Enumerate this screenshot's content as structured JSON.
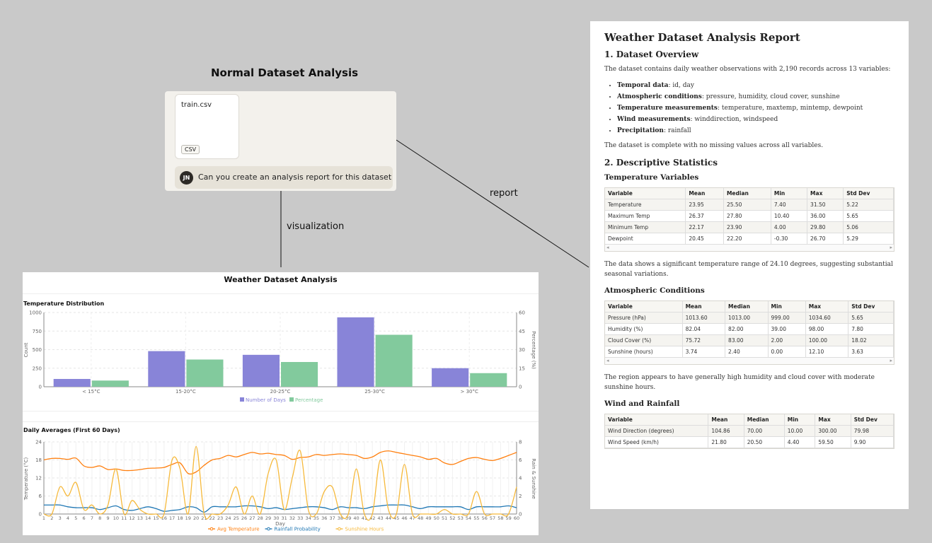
{
  "normal": {
    "title": "Normal Dataset Analysis",
    "file_name": "train.csv",
    "file_type": "CSV",
    "avatar_initials": "JN",
    "message": "Can you create an analysis report for this dataset"
  },
  "labels": {
    "visualization": "visualization",
    "report": "report"
  },
  "dashboard": {
    "title": "Weather Dataset Analysis",
    "chart1_title": "Temperature Distribution",
    "chart2_title": "Daily Averages (First 60 Days)"
  },
  "chart_data": [
    {
      "type": "bar",
      "title": "Temperature Distribution",
      "categories": [
        "< 15°C",
        "15-20°C",
        "20-25°C",
        "25-30°C",
        "> 30°C"
      ],
      "series": [
        {
          "name": "Number of Days",
          "axis": "left",
          "color": "#8884d8",
          "values": [
            105,
            480,
            430,
            935,
            250
          ]
        },
        {
          "name": "Percentage",
          "axis": "right",
          "color": "#82ca9d",
          "values": [
            5,
            22,
            20,
            42,
            11
          ]
        }
      ],
      "ylabel": "Count",
      "ylim": [
        0,
        1000
      ],
      "yticks": [
        0,
        250,
        500,
        750,
        1000
      ],
      "y2label": "Percentage (%)",
      "y2lim": [
        0,
        60
      ],
      "y2ticks": [
        0,
        15,
        30,
        45,
        60
      ],
      "legend": "bottom",
      "grid": true
    },
    {
      "type": "line",
      "title": "Daily Averages (First 60 Days)",
      "xlabel": "Day",
      "x": [
        1,
        2,
        3,
        4,
        5,
        6,
        7,
        8,
        9,
        10,
        11,
        12,
        13,
        14,
        15,
        16,
        17,
        18,
        19,
        20,
        21,
        22,
        23,
        24,
        25,
        26,
        27,
        28,
        29,
        30,
        31,
        32,
        33,
        34,
        35,
        36,
        37,
        38,
        39,
        40,
        41,
        42,
        43,
        44,
        45,
        46,
        47,
        48,
        49,
        50,
        51,
        52,
        53,
        54,
        55,
        56,
        57,
        58,
        59,
        60
      ],
      "ylabel": "Temperature (°C)",
      "ylim": [
        0,
        24
      ],
      "yticks": [
        0,
        6,
        12,
        18,
        24
      ],
      "y2label": "Rain & Sunshine",
      "y2lim": [
        0,
        8
      ],
      "y2ticks": [
        0,
        2,
        4,
        6,
        8
      ],
      "legend": "bottom",
      "grid": true,
      "series": [
        {
          "name": "Avg Temperature",
          "axis": "left",
          "color": "#ff7f0e",
          "values": [
            18,
            18.5,
            18.5,
            18.2,
            18.6,
            16,
            15.5,
            16,
            14.8,
            15,
            14.5,
            14.5,
            14.8,
            15.2,
            15.3,
            15.5,
            16.5,
            17,
            13.5,
            14,
            16.2,
            18,
            18.5,
            19.5,
            19,
            19.8,
            20.5,
            20,
            20.2,
            19.8,
            19.5,
            18.2,
            18.8,
            19,
            19.8,
            19.5,
            19.8,
            20,
            19.8,
            19.5,
            18.5,
            19,
            20.5,
            21,
            20.5,
            20,
            19.5,
            19,
            18.2,
            18.5,
            17,
            16.5,
            17.5,
            18.5,
            18.8,
            18.2,
            17.8,
            18.5,
            19.5,
            20.5
          ]
        },
        {
          "name": "Rainfall Probability",
          "axis": "right",
          "color": "#1f77b4",
          "values": [
            1,
            1,
            1,
            0.8,
            0.7,
            0.7,
            0.7,
            0.5,
            0.7,
            0.9,
            0.5,
            0.4,
            0.6,
            0.8,
            0.6,
            0.3,
            0.4,
            0.5,
            0.8,
            0.7,
            0.2,
            0.8,
            0.8,
            0.8,
            0.8,
            0.9,
            0.9,
            0.8,
            0.6,
            0.7,
            0.5,
            0.6,
            0.7,
            0.8,
            0.8,
            0.7,
            0.5,
            0.8,
            0.7,
            0.7,
            0.6,
            0.8,
            0.9,
            1,
            1,
            1,
            0.8,
            0.6,
            0.8,
            0.8,
            0.8,
            0.8,
            0.8,
            0.5,
            0.8,
            0.8,
            0.8,
            0.8,
            0.9,
            0.7
          ]
        },
        {
          "name": "Sunshine Hours",
          "axis": "right",
          "color": "#f6b93b",
          "values": [
            0,
            0,
            3,
            2,
            3.5,
            0.5,
            1,
            0,
            1,
            5,
            0,
            1.5,
            0.5,
            0,
            0,
            0,
            6,
            5,
            0,
            7.5,
            0,
            0,
            0,
            1,
            3,
            0,
            2,
            0,
            4.5,
            6,
            0.5,
            4,
            7,
            0.5,
            0,
            2.5,
            3,
            0,
            0,
            5,
            0,
            0,
            6,
            0.5,
            0,
            5.5,
            0,
            0,
            0,
            0,
            0.5,
            0,
            0,
            0,
            2.5,
            0,
            0,
            0,
            0,
            3
          ]
        }
      ]
    }
  ],
  "report": {
    "title": "Weather Dataset Analysis Report",
    "s1_heading": "1. Dataset Overview",
    "s1_intro": "The dataset contains daily weather observations with 2,190 records across 13 variables:",
    "s1_items": [
      {
        "label": "Temporal data",
        "text": ": id, day"
      },
      {
        "label": "Atmospheric conditions",
        "text": ": pressure, humidity, cloud cover, sunshine"
      },
      {
        "label": "Temperature measurements",
        "text": ": temperature, maxtemp, mintemp, dewpoint"
      },
      {
        "label": "Wind measurements",
        "text": ": winddirection, windspeed"
      },
      {
        "label": "Precipitation",
        "text": ": rainfall"
      }
    ],
    "s1_outro": "The dataset is complete with no missing values across all variables.",
    "s2_heading": "2. Descriptive Statistics",
    "headers": [
      "Variable",
      "Mean",
      "Median",
      "Min",
      "Max",
      "Std Dev"
    ],
    "temp": {
      "heading": "Temperature Variables",
      "rows": [
        [
          "Temperature",
          "23.95",
          "25.50",
          "7.40",
          "31.50",
          "5.22"
        ],
        [
          "Maximum Temp",
          "26.37",
          "27.80",
          "10.40",
          "36.00",
          "5.65"
        ],
        [
          "Minimum Temp",
          "22.17",
          "23.90",
          "4.00",
          "29.80",
          "5.06"
        ],
        [
          "Dewpoint",
          "20.45",
          "22.20",
          "-0.30",
          "26.70",
          "5.29"
        ]
      ],
      "note": "The data shows a significant temperature range of 24.10 degrees, suggesting substantial seasonal variations."
    },
    "atmo": {
      "heading": "Atmospheric Conditions",
      "rows": [
        [
          "Pressure (hPa)",
          "1013.60",
          "1013.00",
          "999.00",
          "1034.60",
          "5.65"
        ],
        [
          "Humidity (%)",
          "82.04",
          "82.00",
          "39.00",
          "98.00",
          "7.80"
        ],
        [
          "Cloud Cover (%)",
          "75.72",
          "83.00",
          "2.00",
          "100.00",
          "18.02"
        ],
        [
          "Sunshine (hours)",
          "3.74",
          "2.40",
          "0.00",
          "12.10",
          "3.63"
        ]
      ],
      "note": "The region appears to have generally high humidity and cloud cover with moderate sunshine hours."
    },
    "wind": {
      "heading": "Wind and Rainfall",
      "rows": [
        [
          "Wind Direction (degrees)",
          "104.86",
          "70.00",
          "10.00",
          "300.00",
          "79.98"
        ],
        [
          "Wind Speed (km/h)",
          "21.80",
          "20.50",
          "4.40",
          "59.50",
          "9.90"
        ]
      ]
    }
  }
}
